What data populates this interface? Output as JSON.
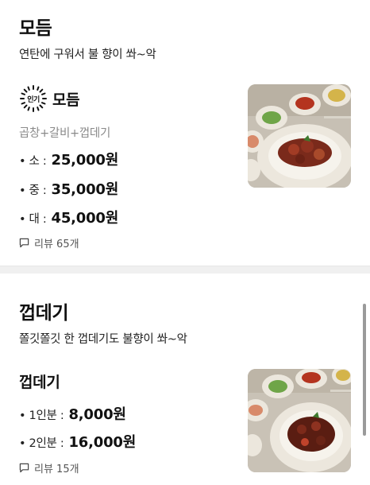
{
  "categories": [
    {
      "title": "모듬",
      "description": "연탄에 구워서 불 향이 쏴~악",
      "menu": {
        "badge": "인기",
        "name": "모듬",
        "subtitle": "곱창+갈비+껍데기",
        "prices": [
          {
            "label": "• 소 :",
            "value": "25,000원"
          },
          {
            "label": "• 중 :",
            "value": "35,000원"
          },
          {
            "label": "• 대 :",
            "value": "45,000원"
          }
        ],
        "reviews": "리뷰 65개",
        "photo_icon": "food-photo"
      }
    },
    {
      "title": "껍데기",
      "description": "쫄깃쫄깃 한 껍데기도 불향이 쏴~악",
      "menu": {
        "name": "껍데기",
        "prices": [
          {
            "label": "• 1인분 :",
            "value": "8,000원"
          },
          {
            "label": "• 2인분 :",
            "value": "16,000원"
          }
        ],
        "reviews": "리뷰 15개",
        "photo_icon": "food-photo"
      }
    }
  ],
  "colors": {
    "divider": "#f0f0f0",
    "subtle_text": "#8a8a8a"
  }
}
